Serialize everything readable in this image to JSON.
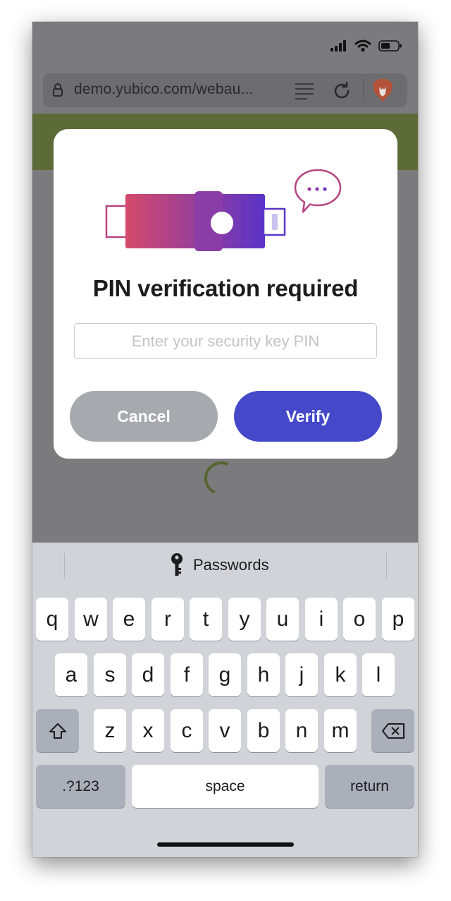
{
  "browser": {
    "url": "demo.yubico.com/webau..."
  },
  "dialog": {
    "title": "PIN verification required",
    "pin_placeholder": "Enter your security key PIN",
    "cancel_label": "Cancel",
    "verify_label": "Verify"
  },
  "keyboard": {
    "passwords_label": "Passwords",
    "row1": [
      "q",
      "w",
      "e",
      "r",
      "t",
      "y",
      "u",
      "i",
      "o",
      "p"
    ],
    "row2": [
      "a",
      "s",
      "d",
      "f",
      "g",
      "h",
      "j",
      "k",
      "l"
    ],
    "row3": [
      "z",
      "x",
      "c",
      "v",
      "b",
      "n",
      "m"
    ],
    "numbers_label": ".?123",
    "space_label": "space",
    "return_label": "return"
  },
  "colors": {
    "verify": "#4448c9",
    "cancel": "#a8a9ae",
    "page_band": "#5d6b39",
    "key_gradient_start": "#d64a6b",
    "key_gradient_end": "#5a33c8"
  },
  "icons": [
    "signal-icon",
    "wifi-icon",
    "battery-icon",
    "lock-icon",
    "reader-mode-icon",
    "reload-icon",
    "brave-lion-icon",
    "key-icon",
    "shift-icon",
    "backspace-icon"
  ]
}
